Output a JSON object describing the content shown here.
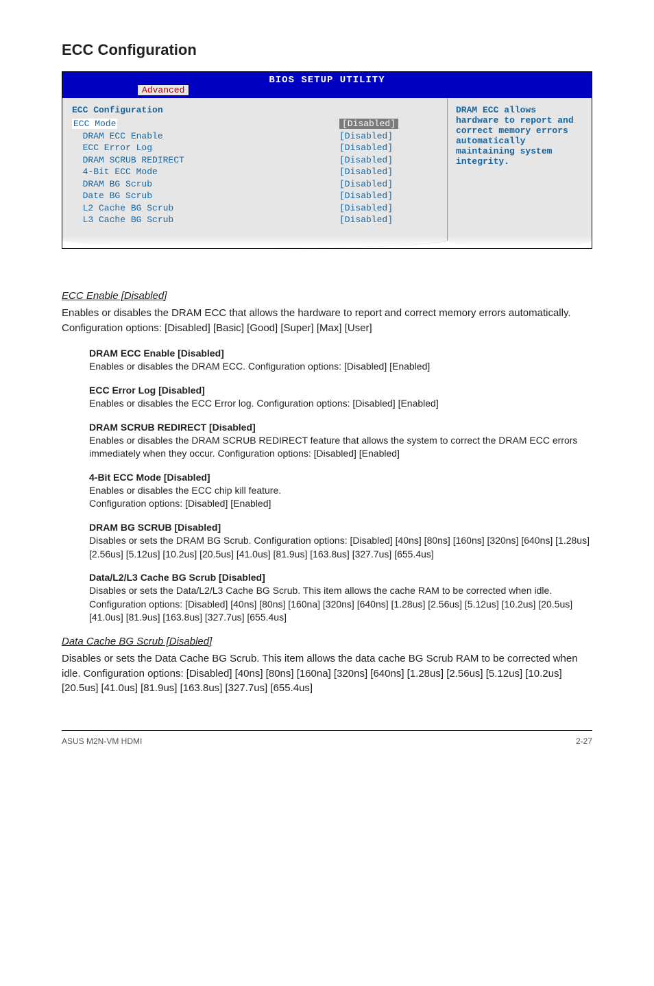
{
  "title": "ECC Configuration",
  "bios": {
    "banner": "BIOS SETUP UTILITY",
    "tab": "Advanced",
    "section_title": "ECC Configuration",
    "rows": [
      {
        "label": "ECC Mode",
        "value": "[Disabled]",
        "highlight": true
      },
      {
        "label": "  DRAM ECC Enable",
        "value": "[Disabled]",
        "highlight": false
      },
      {
        "label": "  ECC Error Log",
        "value": "[Disabled]",
        "highlight": false
      },
      {
        "label": "  DRAM SCRUB REDIRECT",
        "value": "[Disabled]",
        "highlight": false
      },
      {
        "label": "  4-Bit ECC Mode",
        "value": "[Disabled]",
        "highlight": false
      },
      {
        "label": "  DRAM BG Scrub",
        "value": "[Disabled]",
        "highlight": false
      },
      {
        "label": "  Date BG Scrub",
        "value": "[Disabled]",
        "highlight": false
      },
      {
        "label": "  L2 Cache BG Scrub",
        "value": "[Disabled]",
        "highlight": false
      },
      {
        "label": "  L3 Cache BG Scrub",
        "value": "[Disabled]",
        "highlight": false
      }
    ],
    "help": "DRAM ECC allows hardware to report and correct memory errors automatically maintaining system integrity."
  },
  "sections": {
    "ecc_enable": {
      "heading": "ECC Enable [Disabled]",
      "body": "Enables or disables the DRAM ECC that allows the hardware to report and correct memory errors automatically. Configuration options: [Disabled] [Basic] [Good] [Super] [Max] [User]"
    },
    "sub": [
      {
        "h": "DRAM ECC Enable [Disabled]",
        "p": "Enables or disables the DRAM ECC. Configuration options: [Disabled] [Enabled]"
      },
      {
        "h": "ECC Error Log [Disabled]",
        "p": "Enables or disables the ECC Error log. Configuration options: [Disabled] [Enabled]"
      },
      {
        "h": "DRAM SCRUB REDIRECT [Disabled]",
        "p": "Enables or disables the DRAM SCRUB REDIRECT feature that allows the system to correct the DRAM ECC errors immediately when they occur. Configuration options: [Disabled] [Enabled]"
      },
      {
        "h": "4-Bit ECC Mode [Disabled]",
        "p": "Enables or disables the ECC chip kill feature.\nConfiguration options: [Disabled] [Enabled]"
      },
      {
        "h": "DRAM BG SCRUB [Disabled]",
        "p": "Disables or sets the DRAM BG Scrub. Configuration options: [Disabled] [40ns] [80ns] [160ns] [320ns] [640ns] [1.28us] [2.56us] [5.12us] [10.2us] [20.5us] [41.0us] [81.9us] [163.8us] [327.7us] [655.4us]"
      },
      {
        "h": "Data/L2/L3 Cache BG Scrub [Disabled]",
        "p": "Disables or sets the Data/L2/L3 Cache BG Scrub. This item allows the cache RAM to be corrected when idle. Configuration options: [Disabled] [40ns] [80ns] [160na] [320ns] [640ns] [1.28us] [2.56us] [5.12us] [10.2us] [20.5us] [41.0us] [81.9us] [163.8us] [327.7us] [655.4us]"
      }
    ],
    "data_cache": {
      "heading": "Data Cache BG Scrub [Disabled]",
      "body": "Disables or sets the Data Cache BG Scrub. This item allows the data cache BG Scrub RAM to be corrected when idle. Configuration options: [Disabled] [40ns] [80ns] [160na] [320ns] [640ns] [1.28us] [2.56us] [5.12us] [10.2us] [20.5us] [41.0us] [81.9us] [163.8us] [327.7us] [655.4us]"
    }
  },
  "footer": {
    "left": "ASUS M2N-VM HDMI",
    "right": "2-27"
  }
}
